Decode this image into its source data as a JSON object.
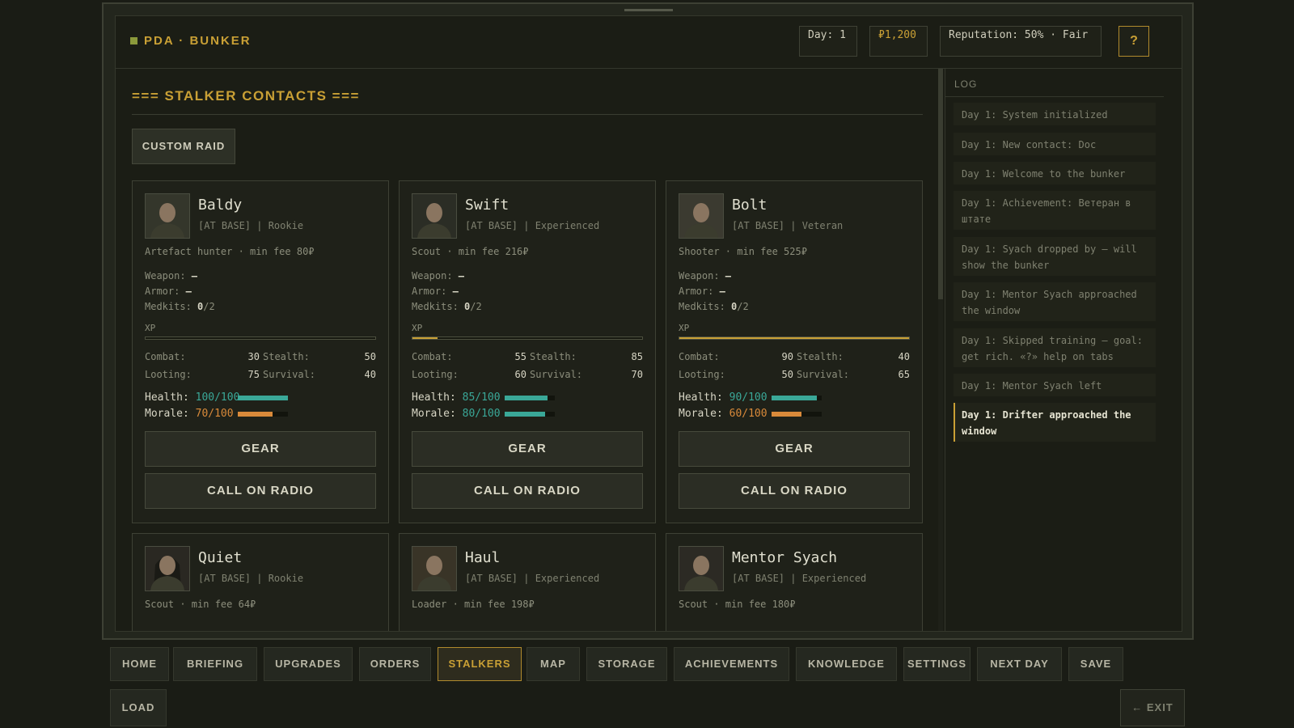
{
  "header": {
    "title": "PDA · BUNKER",
    "day": "Day: 1",
    "money": "₽1,200",
    "reputation": "Reputation: 50% · Fair",
    "help": "?"
  },
  "section": {
    "title": "=== STALKER CONTACTS ===",
    "custom_raid": "CUSTOM RAID"
  },
  "labels": {
    "weapon": "Weapon:",
    "armor": "Armor:",
    "medkits": "Medkits:",
    "xp": "XP",
    "combat": "Combat:",
    "stealth": "Stealth:",
    "looting": "Looting:",
    "survival": "Survival:",
    "health": "Health:",
    "morale": "Morale:",
    "gear": "GEAR",
    "call": "CALL ON RADIO"
  },
  "colors": {
    "accent": "#c9a035",
    "health": "#3aa898",
    "morale_low": "#d98a3a",
    "morale_high": "#3aa898"
  },
  "stalkers": [
    {
      "name": "Baldy",
      "status": "[AT BASE] | Rookie",
      "role": "Artefact hunter · min fee 80₽",
      "weapon": "—",
      "armor": "—",
      "medkits_have": "0",
      "medkits_max": "/2",
      "xp": 0.0,
      "combat": "30",
      "stealth": "50",
      "looting": "75",
      "survival": "40",
      "health_text": "100/100",
      "health": 1.0,
      "morale_text": "70/100",
      "morale": 0.7
    },
    {
      "name": "Swift",
      "status": "[AT BASE] | Experienced",
      "role": "Scout · min fee 216₽",
      "weapon": "—",
      "armor": "—",
      "medkits_have": "0",
      "medkits_max": "/2",
      "xp": 0.11,
      "combat": "55",
      "stealth": "85",
      "looting": "60",
      "survival": "70",
      "health_text": "85/100",
      "health": 0.85,
      "morale_text": "80/100",
      "morale": 0.8
    },
    {
      "name": "Bolt",
      "status": "[AT BASE] | Veteran",
      "role": "Shooter · min fee 525₽",
      "weapon": "—",
      "armor": "—",
      "medkits_have": "0",
      "medkits_max": "/2",
      "xp": 1.0,
      "combat": "90",
      "stealth": "40",
      "looting": "50",
      "survival": "65",
      "health_text": "90/100",
      "health": 0.9,
      "morale_text": "60/100",
      "morale": 0.6
    },
    {
      "name": "Quiet",
      "status": "[AT BASE] | Rookie",
      "role": "Scout · min fee 64₽"
    },
    {
      "name": "Haul",
      "status": "[AT BASE] | Experienced",
      "role": "Loader · min fee 198₽"
    },
    {
      "name": "Mentor Syach",
      "status": "[AT BASE] | Experienced",
      "role": "Scout · min fee 180₽"
    }
  ],
  "log": {
    "title": "LOG",
    "entries": [
      "Day 1: System initialized",
      "Day 1: New contact: Doc",
      "Day 1: Welcome to the bunker",
      "Day 1: Achievement: Ветеран в штате",
      "Day 1: Syach dropped by — will show the bunker",
      "Day 1: Mentor Syach approached the window",
      "Day 1: Skipped training — goal: get rich. «?» help on tabs",
      "Day 1: Mentor Syach left",
      "Day 1: Drifter approached the window"
    ]
  },
  "nav": {
    "items": [
      "HOME",
      "BRIEFING",
      "UPGRADES",
      "ORDERS",
      "STALKERS",
      "MAP",
      "STORAGE",
      "ACHIEVEMENTS",
      "KNOWLEDGE",
      "SETTINGS",
      "NEXT DAY",
      "SAVE"
    ],
    "active": "STALKERS",
    "load": "LOAD",
    "exit": "← EXIT"
  }
}
